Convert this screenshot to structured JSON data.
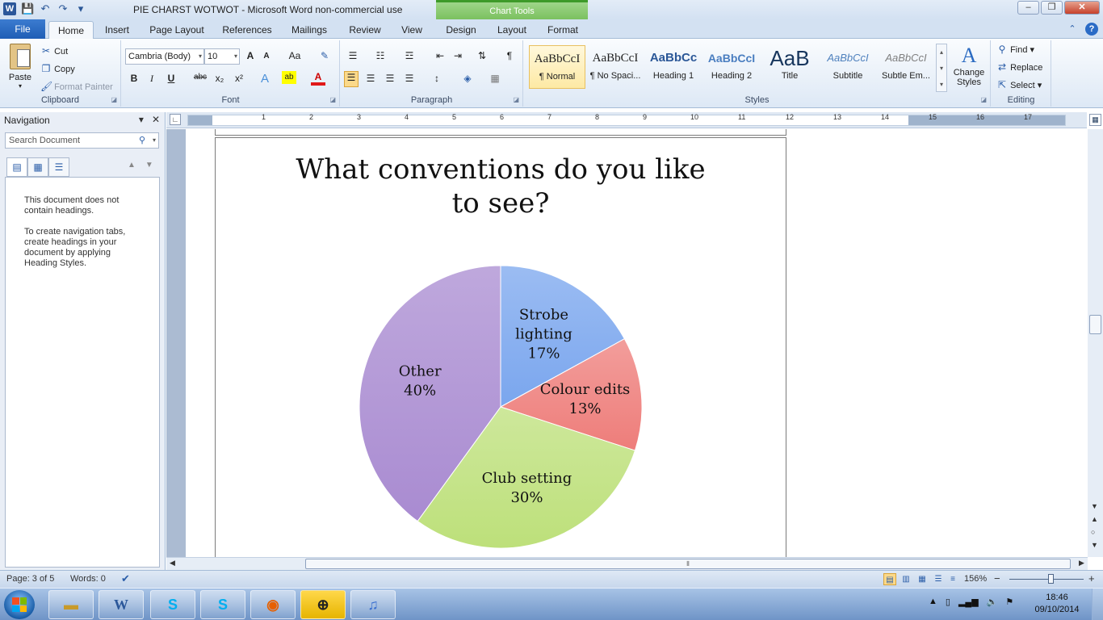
{
  "window": {
    "title": "PIE CHARST WOTWOT  -  Microsoft Word non-commercial use",
    "contextual_group": "Chart Tools",
    "controls": [
      "–",
      "❐",
      "✕"
    ]
  },
  "qat": {
    "word_logo": "W",
    "save": "💾",
    "undo": "↶",
    "redo": "↷",
    "customize": "▾"
  },
  "tabs": {
    "file": "File",
    "items": [
      "Home",
      "Insert",
      "Page Layout",
      "References",
      "Mailings",
      "Review",
      "View"
    ],
    "contextual": [
      "Design",
      "Layout",
      "Format"
    ],
    "active": "Home"
  },
  "ribbon": {
    "clipboard": {
      "label": "Clipboard",
      "paste": "Paste",
      "cut": "Cut",
      "copy": "Copy",
      "format_painter": "Format Painter"
    },
    "font": {
      "label": "Font",
      "font_name": "Cambria (Body)",
      "font_size": "10",
      "grow": "A",
      "shrink": "A",
      "change_case": "Aa",
      "clear": "✎",
      "bold": "B",
      "italic": "I",
      "underline": "U",
      "strike": "abc",
      "sub": "x₂",
      "sup": "x²",
      "effects": "A",
      "highlight": "ab",
      "color": "A"
    },
    "paragraph": {
      "label": "Paragraph"
    },
    "styles": {
      "label": "Styles",
      "items": [
        {
          "sample": "AaBbCcI",
          "name": "¶ Normal"
        },
        {
          "sample": "AaBbCcI",
          "name": "¶ No Spaci..."
        },
        {
          "sample": "AaBbCc",
          "name": "Heading 1"
        },
        {
          "sample": "AaBbCcI",
          "name": "Heading 2"
        },
        {
          "sample": "AaB",
          "name": "Title"
        },
        {
          "sample": "AaBbCcI",
          "name": "Subtitle"
        },
        {
          "sample": "AaBbCcI",
          "name": "Subtle Em..."
        }
      ],
      "change_styles": "Change Styles"
    },
    "editing": {
      "label": "Editing",
      "find": "Find",
      "replace": "Replace",
      "select": "Select"
    }
  },
  "navigation": {
    "title": "Navigation",
    "search_placeholder": "Search Document",
    "message1": "This document does not contain headings.",
    "message2": "To create navigation tabs, create headings in your document by applying Heading Styles."
  },
  "ruler": {
    "numbers": [
      "1",
      "2",
      "3",
      "4",
      "5",
      "6",
      "7",
      "8",
      "9",
      "10",
      "11",
      "12",
      "13",
      "14",
      "15",
      "16",
      "17"
    ]
  },
  "chart_data": {
    "type": "pie",
    "title": "What conventions do you like to see?",
    "slices": [
      {
        "label": "Strobe lighting",
        "value": 17,
        "display": "17%",
        "color": "#7aa6ee"
      },
      {
        "label": "Colour edits",
        "value": 13,
        "display": "13%",
        "color": "#ee7d7a"
      },
      {
        "label": "Club setting",
        "value": 30,
        "display": "30%",
        "color": "#bde07a"
      },
      {
        "label": "Other",
        "value": 40,
        "display": "40%",
        "color": "#a98bd1"
      }
    ]
  },
  "status": {
    "page": "Page: 3 of 5",
    "words": "Words: 0",
    "zoom": "156%",
    "zoom_minus": "−",
    "zoom_plus": "+"
  },
  "taskbar": {
    "apps": [
      "word",
      "skype",
      "skype",
      "firefox",
      "norton",
      "itunes"
    ],
    "time": "18:46",
    "date": "09/10/2014"
  }
}
